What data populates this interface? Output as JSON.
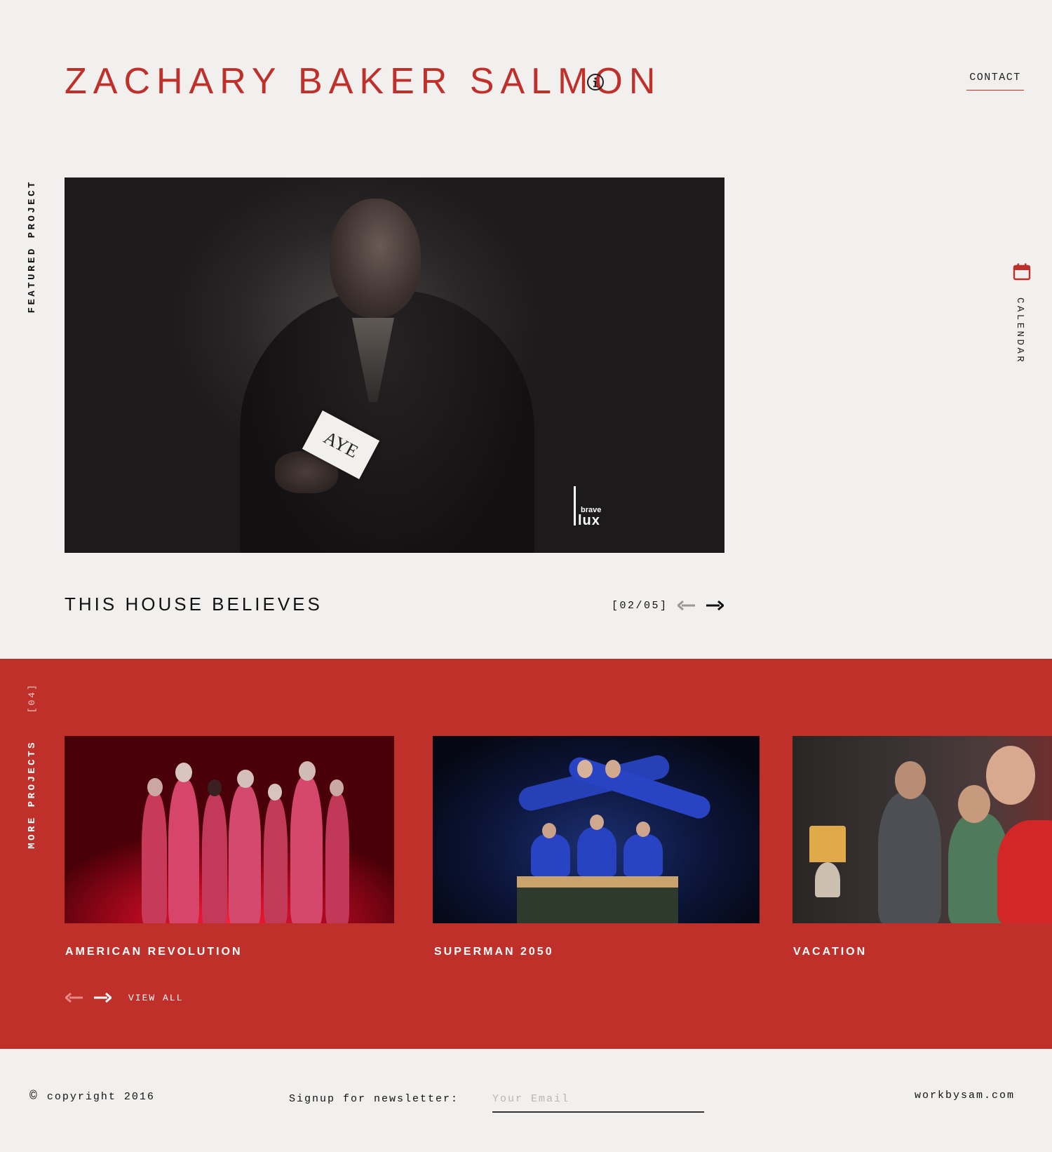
{
  "header": {
    "title": "ZACHARY BAKER SALMON",
    "contact_label": "CONTACT",
    "info_icon": "info-icon"
  },
  "colors": {
    "accent": "#c0302b",
    "background": "#f1f0ee",
    "text": "#111111"
  },
  "featured": {
    "label": "FEATURED PROJECT",
    "card_text": "AYE",
    "logo_brave": "brave",
    "logo_lux": "lux",
    "title": "THIS HOUSE BELIEVES",
    "pager": "[02/05]",
    "prev_icon": "arrow-left-icon",
    "next_icon": "arrow-right-icon"
  },
  "calendar": {
    "label": "CALENDAR",
    "icon": "calendar-icon"
  },
  "projects": {
    "label": "MORE PROJECTS",
    "count": "[04]",
    "items": [
      {
        "title": "AMERICAN REVOLUTION"
      },
      {
        "title": "SUPERMAN 2050"
      },
      {
        "title": "VACATION"
      }
    ],
    "view_all_label": "VIEW ALL"
  },
  "footer": {
    "copyright": "copyright 2016",
    "newsletter_label": "Signup for newsletter:",
    "email_placeholder": "Your Email",
    "site_url": "workbysam.com"
  }
}
